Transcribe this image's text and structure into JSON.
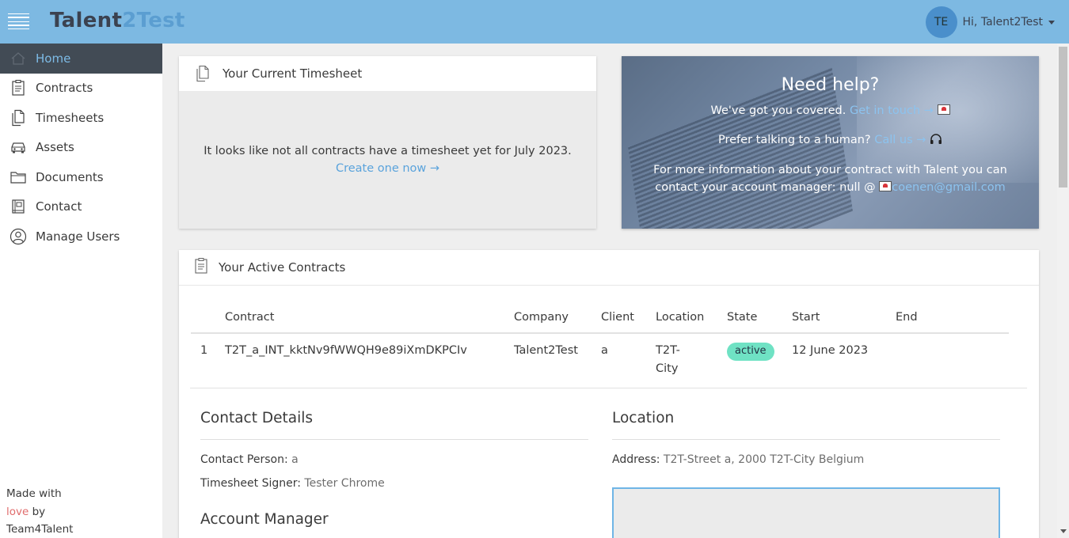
{
  "header": {
    "logo_part1": "Talent",
    "logo_part2": "2Test",
    "avatar_initials": "TE",
    "greeting": "Hi, Talent2Test"
  },
  "sidebar": {
    "items": [
      {
        "label": "Home",
        "icon": "home-icon"
      },
      {
        "label": "Contracts",
        "icon": "clipboard-icon"
      },
      {
        "label": "Timesheets",
        "icon": "documents-icon"
      },
      {
        "label": "Assets",
        "icon": "car-icon"
      },
      {
        "label": "Documents",
        "icon": "folder-icon"
      },
      {
        "label": "Contact",
        "icon": "book-icon"
      },
      {
        "label": "Manage Users",
        "icon": "user-icon"
      }
    ],
    "footer_made_with": "Made with",
    "footer_love": "love",
    "footer_by": " by",
    "footer_team": "Team4Talent"
  },
  "timesheet_card": {
    "title": "Your Current Timesheet",
    "message": "It looks like not all contracts have a timesheet yet for July 2023.",
    "action_link": "Create one now →"
  },
  "help_card": {
    "title": "Need help?",
    "line1_text": "We've got you covered.",
    "line1_link": "Get in touch →",
    "line2_text": "Prefer talking to a human?",
    "line2_link": "Call us →",
    "line3_text": "For more information about your contract with Talent you can",
    "line4_text": "contact your account manager: null @",
    "line4_email": "coenen@gmail.com"
  },
  "contracts_card": {
    "title": "Your Active Contracts",
    "columns": [
      "",
      "Contract",
      "Company",
      "Client",
      "Location",
      "State",
      "Start",
      "End"
    ],
    "rows": [
      {
        "index": "1",
        "contract": "T2T_a_INT_kktNv9fWWQH9e89iXmDKPCIv",
        "company": "Talent2Test",
        "client": "a",
        "location_line1": "T2T-",
        "location_line2": "City",
        "state": "active",
        "start": "12 June 2023",
        "end": ""
      }
    ]
  },
  "contact_details": {
    "title": "Contact Details",
    "contact_person_label": "Contact Person: ",
    "contact_person_value": "a",
    "signer_label": "Timesheet Signer: ",
    "signer_value": "Tester Chrome"
  },
  "account_manager": {
    "title": "Account Manager"
  },
  "location_section": {
    "title": "Location",
    "address_label": "Address: ",
    "address_value": "T2T-Street a, 2000 T2T-City Belgium"
  },
  "colors": {
    "header_bg": "#7db9e2",
    "sidebar_active_bg": "#424b55",
    "link": "#5aa3dc",
    "badge_active": "#6fe2c4"
  }
}
